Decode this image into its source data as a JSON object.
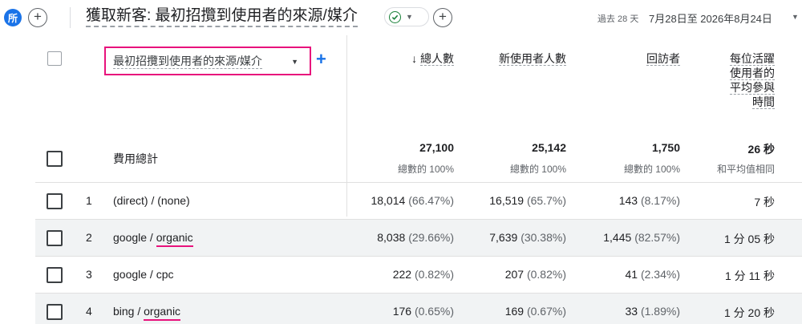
{
  "header": {
    "all_badge": "所",
    "report_title": "獲取新客: 最初招攬到使用者的來源/媒介",
    "date_prefix": "過去 28 天",
    "date_range": "7月28日至 2026年8月24日",
    "icons": {
      "add": "plus-icon",
      "check": "check-circle-icon",
      "dropdown": "chevron-down-icon"
    }
  },
  "table": {
    "dimension_label": "最初招攬到使用者的來源/媒介",
    "columns": [
      {
        "label": "總人數",
        "sorted": "descending",
        "sort_icon": "↓"
      },
      {
        "label": "新使用者人數"
      },
      {
        "label": "回訪者"
      },
      {
        "label": "每位活躍使用者的平均參與時間"
      }
    ],
    "totals": {
      "label": "費用總計",
      "values": [
        "27,100",
        "25,142",
        "1,750",
        "26 秒"
      ],
      "subs": [
        "總數的 100%",
        "總數的 100%",
        "總數的 100%",
        "和平均值相同"
      ]
    },
    "rows": [
      {
        "index": "1",
        "source": "(direct) / (none)",
        "source_a": "(direct) / (none)",
        "source_b": "",
        "highlight": false,
        "c1": "18,014",
        "c1p": "(66.47%)",
        "c2": "16,519",
        "c2p": "(65.7%)",
        "c3": "143",
        "c3p": "(8.17%)",
        "c4": "7 秒"
      },
      {
        "index": "2",
        "source": "google / organic",
        "source_a": "google / ",
        "source_b": "organic",
        "highlight": true,
        "c1": "8,038",
        "c1p": "(29.66%)",
        "c2": "7,639",
        "c2p": "(30.38%)",
        "c3": "1,445",
        "c3p": "(82.57%)",
        "c4": "1 分 05 秒"
      },
      {
        "index": "3",
        "source": "google / cpc",
        "source_a": "google / cpc",
        "source_b": "",
        "highlight": false,
        "c1": "222",
        "c1p": "(0.82%)",
        "c2": "207",
        "c2p": "(0.82%)",
        "c3": "41",
        "c3p": "(2.34%)",
        "c4": "1 分 11 秒"
      },
      {
        "index": "4",
        "source": "bing / organic",
        "source_a": "bing / ",
        "source_b": "organic",
        "highlight": true,
        "c1": "176",
        "c1p": "(0.65%)",
        "c2": "169",
        "c2p": "(0.67%)",
        "c3": "33",
        "c3p": "(1.89%)",
        "c4": "1 分 20 秒"
      }
    ]
  },
  "colors": {
    "accent": "#1a73e8",
    "highlight_pink": "#e8127c",
    "success_green": "#188038"
  }
}
